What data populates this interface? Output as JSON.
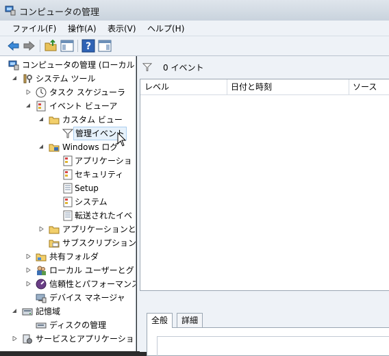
{
  "window": {
    "title": "コンピュータの管理"
  },
  "menu": [
    {
      "label": "ファイル(F)"
    },
    {
      "label": "操作(A)"
    },
    {
      "label": "表示(V)"
    },
    {
      "label": "ヘルプ(H)"
    }
  ],
  "tree": {
    "root": "コンピュータの管理 (ローカル",
    "system_tools": "システム ツール",
    "task_scheduler": "タスク スケジューラ",
    "event_viewer": "イベント ビューア",
    "custom_views": "カスタム ビュー",
    "admin_events": "管理イベント",
    "windows_logs": "Windows ログ",
    "application": "アプリケーショ",
    "security": "セキュリティ",
    "setup": "Setup",
    "system": "システム",
    "forwarded": "転送されたイベ",
    "apps_services": "アプリケーションと",
    "subscriptions": "サブスクリプション",
    "shared_folders": "共有フォルダ",
    "local_users": "ローカル ユーザーとグ",
    "reliability": "信頼性とパフォーマンス",
    "device_manager": "デバイス マネージャ",
    "storage": "記憶域",
    "disk_management": "ディスクの管理",
    "services_apps": "サービスとアプリケーショ"
  },
  "right": {
    "filter_label": "0 イベント",
    "columns": [
      "レベル",
      "日付と時刻",
      "ソース"
    ]
  },
  "detail": {
    "tabs": [
      "全般",
      "詳細"
    ]
  }
}
